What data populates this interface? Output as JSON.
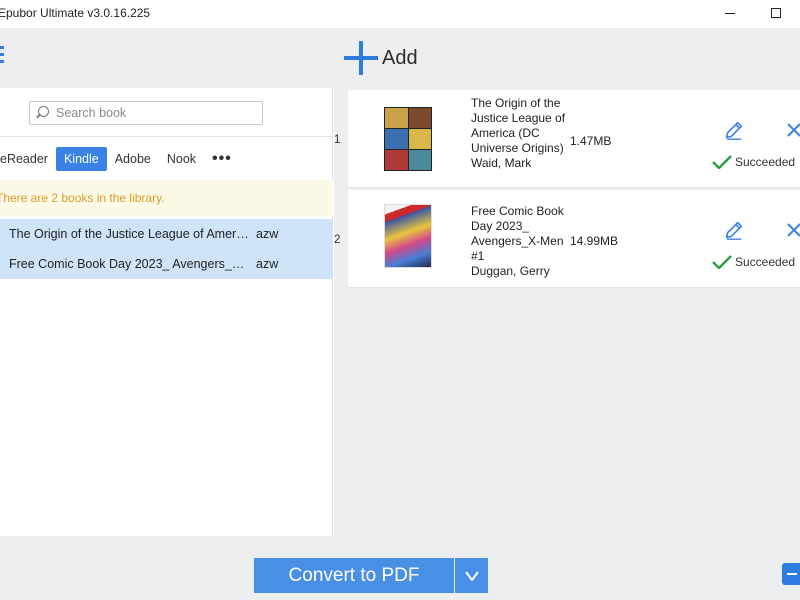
{
  "window": {
    "title": "Epubor Ultimate v3.0.16.225"
  },
  "toolbar": {
    "add_label": "Add"
  },
  "left_panel": {
    "search_placeholder": "Search book",
    "tabs": [
      "eReader",
      "Kindle",
      "Adobe",
      "Nook"
    ],
    "active_tab": "Kindle",
    "info": "There are 2 books in the library.",
    "books": [
      {
        "title": "The Origin of the Justice League of America (DC Universe Origins)",
        "format": "azw"
      },
      {
        "title": "Free Comic Book Day 2023_ Avengers_X-Men #1",
        "format": "azw"
      }
    ]
  },
  "right_panel": {
    "items": [
      {
        "index": "1",
        "title": "The Origin of the Justice League of America (DC Universe Origins)",
        "author": "Waid, Mark",
        "size": "1.47MB",
        "status": "Succeeded"
      },
      {
        "index": "2",
        "title": "Free Comic Book Day 2023_ Avengers_X-Men #1",
        "author": "Duggan, Gerry",
        "size": "14.99MB",
        "status": "Succeeded"
      }
    ]
  },
  "bottom": {
    "convert_label": "Convert to PDF"
  },
  "colors": {
    "accent": "#3b82e6",
    "selected_row": "#cfe4f9",
    "info_text": "#d89d26",
    "success": "#2ea043"
  }
}
